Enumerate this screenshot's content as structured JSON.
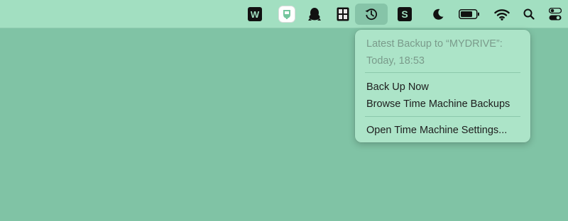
{
  "menubar": {
    "icons": [
      {
        "name": "wps-office-icon",
        "glyph": "W"
      },
      {
        "name": "chatgpt-like-app-icon"
      },
      {
        "name": "qq-penguin-icon"
      },
      {
        "name": "grid-app-icon"
      },
      {
        "name": "time-machine-icon"
      },
      {
        "name": "s-app-icon",
        "glyph": "S"
      },
      {
        "name": "focus-moon-icon"
      },
      {
        "name": "battery-icon"
      },
      {
        "name": "wifi-icon"
      },
      {
        "name": "spotlight-search-icon"
      },
      {
        "name": "control-center-icon"
      }
    ]
  },
  "time_machine_menu": {
    "latest_backup_label": "Latest Backup to “MYDRIVE”:",
    "latest_backup_time": "Today, 18:53",
    "back_up_now": "Back Up Now",
    "browse_backups": "Browse Time Machine Backups",
    "open_settings": "Open Time Machine Settings..."
  },
  "colors": {
    "desktop": "#80c3a5",
    "menubar": "#a2dfc1",
    "menu_background": "#ace4c8",
    "icon_dark": "#111111"
  }
}
